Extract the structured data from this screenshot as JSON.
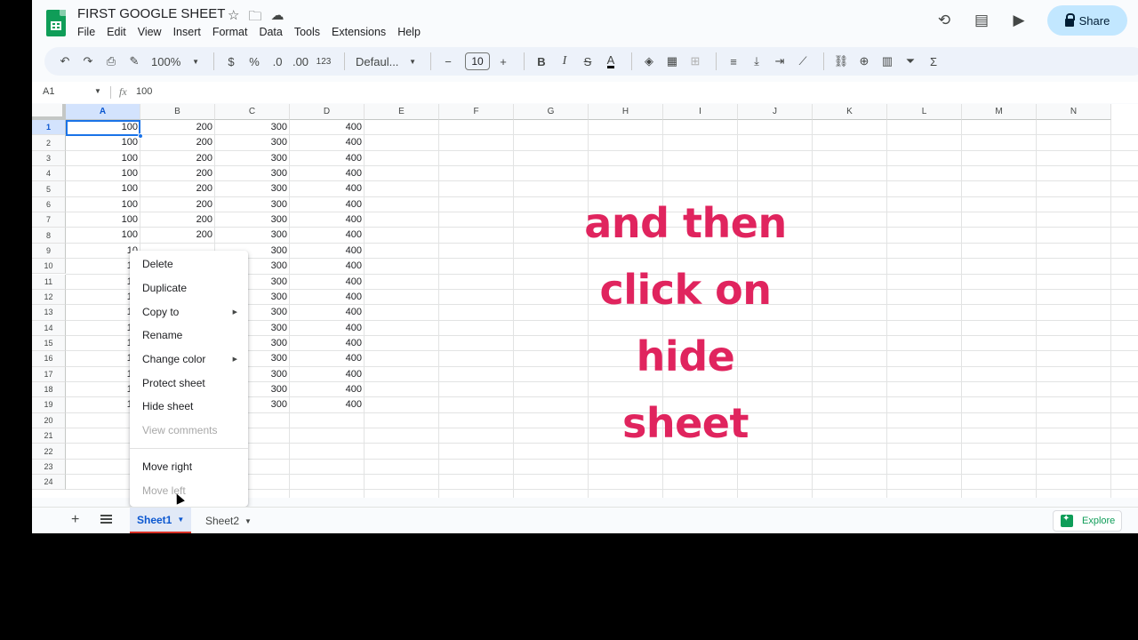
{
  "doc": {
    "title": "FIRST GOOGLE SHEET",
    "menu": [
      "File",
      "Edit",
      "View",
      "Insert",
      "Format",
      "Data",
      "Tools",
      "Extensions",
      "Help"
    ],
    "share_label": "Share"
  },
  "toolbar": {
    "zoom": "100%",
    "currency": "$",
    "percent": "%",
    "dec_decrease": ".0",
    "dec_increase": ".00",
    "more_formats": "123",
    "font": "Defaul...",
    "font_size": "10"
  },
  "formula": {
    "cell_ref": "A1",
    "value": "100"
  },
  "columns": [
    "A",
    "B",
    "C",
    "D",
    "E",
    "F",
    "G",
    "H",
    "I",
    "J",
    "K",
    "L",
    "M",
    "N"
  ],
  "rows": [
    "1",
    "2",
    "3",
    "4",
    "5",
    "6",
    "7",
    "8",
    "9",
    "10",
    "11",
    "12",
    "13",
    "14",
    "15",
    "16",
    "17",
    "18",
    "19",
    "20",
    "21",
    "22",
    "23",
    "24"
  ],
  "cells": [
    [
      "100",
      "200",
      "300",
      "400"
    ],
    [
      "100",
      "200",
      "300",
      "400"
    ],
    [
      "100",
      "200",
      "300",
      "400"
    ],
    [
      "100",
      "200",
      "300",
      "400"
    ],
    [
      "100",
      "200",
      "300",
      "400"
    ],
    [
      "100",
      "200",
      "300",
      "400"
    ],
    [
      "100",
      "200",
      "300",
      "400"
    ],
    [
      "100",
      "200",
      "300",
      "400"
    ],
    [
      "10",
      "",
      "300",
      "400"
    ],
    [
      "10",
      "",
      "300",
      "400"
    ],
    [
      "10",
      "",
      "300",
      "400"
    ],
    [
      "10",
      "",
      "300",
      "400"
    ],
    [
      "10",
      "",
      "300",
      "400"
    ],
    [
      "10",
      "",
      "300",
      "400"
    ],
    [
      "10",
      "",
      "300",
      "400"
    ],
    [
      "10",
      "",
      "300",
      "400"
    ],
    [
      "10",
      "",
      "300",
      "400"
    ],
    [
      "10",
      "",
      "300",
      "400"
    ],
    [
      "10",
      "",
      "300",
      "400"
    ]
  ],
  "caption": [
    "and then",
    "click on",
    "hide",
    "sheet"
  ],
  "context_menu": {
    "items": [
      {
        "label": "Delete",
        "disabled": false,
        "submenu": false
      },
      {
        "label": "Duplicate",
        "disabled": false,
        "submenu": false
      },
      {
        "label": "Copy to",
        "disabled": false,
        "submenu": true
      },
      {
        "label": "Rename",
        "disabled": false,
        "submenu": false
      },
      {
        "label": "Change color",
        "disabled": false,
        "submenu": true
      },
      {
        "label": "Protect sheet",
        "disabled": false,
        "submenu": false
      },
      {
        "label": "Hide sheet",
        "disabled": false,
        "submenu": false
      },
      {
        "label": "View comments",
        "disabled": true,
        "submenu": false
      }
    ],
    "items_after_divider": [
      {
        "label": "Move right",
        "disabled": false
      },
      {
        "label": "Move left",
        "disabled": true
      }
    ]
  },
  "sheets": [
    {
      "label": "Sheet1",
      "active": true
    },
    {
      "label": "Sheet2",
      "active": false
    }
  ],
  "explore_label": "Explore",
  "colors": {
    "accent": "#1a73e8",
    "caption": "#e0245e",
    "share_bg": "#c2e7ff",
    "brand_green": "#0f9d58"
  }
}
